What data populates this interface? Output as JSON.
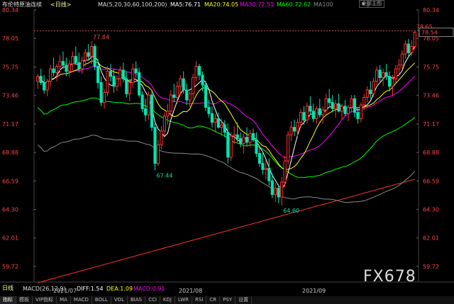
{
  "header": {
    "instrument": "布伦特原油连续",
    "period": "<日线>",
    "ma_params": "MA(5,20,30,60,100,200)",
    "ma5": "MA5:76.71",
    "ma20": "MA20:74.05",
    "ma30": "MA30:72.51",
    "ma60": "MA60:72.62",
    "ma100": "MA100",
    "all_button": "全部主图",
    "colors": {
      "ma5": "#ffffff",
      "ma20": "#ffff00",
      "ma30": "#ff00ff",
      "ma60": "#00ff00",
      "ma100": "#888888",
      "ma200": "#ff3333"
    }
  },
  "footer": {
    "period_label": "日线",
    "macd_label": "MACD(26,12,9)",
    "diff": "DIFF:1.54",
    "dea": "DEA:1.09",
    "macd": "MACD:0.91",
    "dates": [
      "2021/07",
      "2021/08",
      "2021/09"
    ],
    "tabs": [
      "指标",
      "模板",
      "VIP指标",
      "MA",
      "MACD",
      "BOLL",
      "VOL",
      "BIAS",
      "CCI",
      "KDJ",
      "LWR",
      "RSI",
      "CR",
      "PSY",
      "设置"
    ],
    "watermark": "FX678"
  },
  "chart_data": {
    "type": "candlestick",
    "ylim": [
      58.46,
      80.34
    ],
    "y_ticks": [
      "80.34",
      "78.05",
      "75.75",
      "73.46",
      "71.17",
      "68.88",
      "66.59",
      "64.30",
      "62.01",
      "59.72"
    ],
    "last_price": "78.54",
    "dashed_level": 78.65,
    "annotations": [
      {
        "label": "77.84",
        "value": 77.84,
        "index": 17
      },
      {
        "label": "67.44",
        "value": 67.44,
        "index": 37
      },
      {
        "label": "64.60",
        "value": 64.6,
        "index": 77
      },
      {
        "label": "78.65",
        "value": 78.65,
        "index": 119
      }
    ],
    "candles": [
      [
        74.6,
        75.2,
        74.0,
        75.0
      ],
      [
        75.0,
        75.6,
        74.3,
        74.5
      ],
      [
        74.5,
        75.1,
        73.6,
        73.9
      ],
      [
        73.9,
        74.8,
        73.4,
        74.6
      ],
      [
        74.6,
        75.9,
        74.2,
        75.6
      ],
      [
        75.6,
        76.5,
        75.0,
        75.3
      ],
      [
        75.3,
        76.0,
        74.6,
        75.8
      ],
      [
        75.8,
        76.7,
        75.2,
        76.2
      ],
      [
        76.2,
        77.0,
        75.6,
        75.9
      ],
      [
        75.9,
        76.5,
        75.0,
        75.4
      ],
      [
        75.4,
        76.3,
        74.9,
        76.0
      ],
      [
        76.0,
        77.0,
        75.5,
        76.6
      ],
      [
        76.6,
        77.4,
        76.0,
        76.1
      ],
      [
        76.1,
        76.9,
        75.3,
        75.6
      ],
      [
        75.6,
        76.6,
        75.2,
        76.3
      ],
      [
        76.3,
        77.2,
        75.8,
        76.9
      ],
      [
        76.9,
        77.6,
        76.3,
        76.6
      ],
      [
        76.6,
        77.84,
        76.0,
        77.4
      ],
      [
        77.4,
        77.6,
        75.5,
        75.8
      ],
      [
        75.8,
        76.4,
        74.0,
        74.5
      ],
      [
        74.5,
        75.0,
        72.6,
        72.9
      ],
      [
        72.9,
        74.0,
        72.4,
        73.7
      ],
      [
        73.7,
        75.8,
        73.4,
        75.4
      ],
      [
        75.4,
        76.0,
        74.6,
        75.0
      ],
      [
        75.0,
        75.6,
        73.7,
        74.2
      ],
      [
        74.2,
        75.1,
        73.8,
        74.8
      ],
      [
        74.8,
        75.8,
        74.2,
        75.5
      ],
      [
        75.5,
        76.1,
        74.5,
        74.8
      ],
      [
        74.8,
        75.4,
        73.3,
        73.6
      ],
      [
        73.6,
        74.8,
        73.0,
        74.5
      ],
      [
        74.5,
        76.0,
        74.1,
        75.6
      ],
      [
        75.6,
        76.2,
        74.9,
        75.3
      ],
      [
        75.3,
        75.7,
        73.3,
        73.5
      ],
      [
        73.5,
        73.8,
        72.1,
        72.4
      ],
      [
        72.4,
        73.2,
        71.4,
        71.9
      ],
      [
        71.9,
        73.8,
        71.5,
        73.5
      ],
      [
        73.5,
        73.8,
        70.6,
        70.9
      ],
      [
        70.9,
        71.2,
        67.44,
        68.0
      ],
      [
        68.0,
        69.9,
        67.8,
        69.5
      ],
      [
        69.5,
        71.0,
        69.1,
        70.6
      ],
      [
        70.6,
        72.1,
        70.2,
        71.8
      ],
      [
        71.8,
        72.8,
        71.1,
        72.2
      ],
      [
        72.2,
        73.9,
        71.8,
        73.5
      ],
      [
        73.5,
        74.4,
        72.9,
        73.3
      ],
      [
        73.3,
        74.6,
        72.8,
        74.2
      ],
      [
        74.2,
        75.1,
        73.5,
        74.8
      ],
      [
        74.8,
        75.4,
        73.6,
        73.9
      ],
      [
        73.9,
        74.4,
        72.7,
        73.1
      ],
      [
        73.1,
        73.9,
        72.5,
        73.6
      ],
      [
        73.6,
        75.2,
        73.2,
        74.9
      ],
      [
        74.9,
        76.2,
        74.6,
        75.8
      ],
      [
        75.8,
        76.0,
        74.7,
        75.1
      ],
      [
        75.1,
        75.4,
        73.8,
        74.3
      ],
      [
        74.3,
        74.6,
        72.2,
        72.5
      ],
      [
        72.5,
        73.1,
        71.7,
        72.0
      ],
      [
        72.0,
        72.6,
        70.9,
        71.3
      ],
      [
        71.3,
        72.0,
        70.6,
        71.6
      ],
      [
        71.6,
        72.1,
        70.8,
        70.9
      ],
      [
        70.9,
        71.6,
        70.2,
        71.1
      ],
      [
        71.1,
        71.5,
        70.1,
        70.5
      ],
      [
        70.5,
        71.2,
        68.0,
        68.5
      ],
      [
        68.5,
        70.5,
        68.2,
        70.2
      ],
      [
        70.2,
        71.0,
        69.6,
        70.3
      ],
      [
        70.3,
        71.3,
        69.7,
        70.0
      ],
      [
        70.0,
        70.5,
        69.3,
        69.6
      ],
      [
        69.6,
        70.4,
        68.8,
        70.1
      ],
      [
        70.1,
        70.9,
        69.4,
        69.7
      ],
      [
        69.7,
        70.7,
        69.3,
        70.4
      ],
      [
        70.4,
        70.8,
        69.7,
        69.9
      ],
      [
        69.9,
        70.5,
        68.5,
        68.8
      ],
      [
        68.8,
        69.4,
        67.7,
        68.0
      ],
      [
        68.0,
        68.9,
        67.1,
        67.5
      ],
      [
        67.5,
        68.3,
        66.7,
        67.6
      ],
      [
        67.6,
        68.4,
        66.2,
        66.6
      ],
      [
        66.6,
        67.2,
        65.2,
        65.5
      ],
      [
        65.5,
        66.4,
        64.9,
        66.0
      ],
      [
        66.0,
        66.3,
        64.8,
        65.3
      ],
      [
        65.3,
        66.9,
        64.6,
        66.5
      ],
      [
        66.5,
        68.6,
        66.1,
        68.2
      ],
      [
        68.2,
        70.6,
        67.9,
        70.3
      ],
      [
        70.3,
        71.4,
        69.8,
        70.9
      ],
      [
        70.9,
        71.5,
        70.2,
        70.6
      ],
      [
        70.6,
        71.6,
        70.1,
        71.3
      ],
      [
        71.3,
        72.4,
        70.9,
        72.1
      ],
      [
        72.1,
        72.6,
        71.1,
        71.5
      ],
      [
        71.5,
        72.9,
        71.2,
        72.6
      ],
      [
        72.6,
        73.4,
        71.9,
        72.2
      ],
      [
        72.2,
        72.8,
        71.3,
        71.6
      ],
      [
        71.6,
        72.6,
        71.2,
        72.4
      ],
      [
        72.4,
        73.2,
        71.7,
        71.9
      ],
      [
        71.9,
        72.6,
        71.2,
        72.3
      ],
      [
        72.3,
        73.6,
        71.9,
        73.2
      ],
      [
        73.2,
        74.0,
        72.6,
        72.9
      ],
      [
        72.9,
        73.5,
        72.1,
        72.4
      ],
      [
        72.4,
        73.1,
        71.7,
        72.8
      ],
      [
        72.8,
        73.6,
        72.1,
        72.2
      ],
      [
        72.2,
        72.8,
        71.5,
        72.6
      ],
      [
        72.6,
        73.1,
        71.8,
        72.0
      ],
      [
        72.0,
        72.7,
        71.4,
        72.5
      ],
      [
        72.5,
        73.5,
        72.1,
        73.2
      ],
      [
        73.2,
        73.5,
        71.7,
        72.1
      ],
      [
        72.1,
        72.5,
        71.2,
        71.6
      ],
      [
        71.6,
        72.9,
        71.3,
        72.7
      ],
      [
        72.7,
        73.6,
        72.3,
        73.3
      ],
      [
        73.3,
        74.2,
        72.9,
        73.9
      ],
      [
        73.9,
        74.6,
        73.2,
        73.6
      ],
      [
        73.6,
        74.9,
        73.3,
        74.6
      ],
      [
        74.6,
        75.8,
        74.3,
        75.5
      ],
      [
        75.5,
        75.9,
        74.6,
        74.9
      ],
      [
        74.9,
        75.6,
        74.2,
        75.3
      ],
      [
        75.3,
        76.0,
        74.7,
        75.0
      ],
      [
        75.0,
        75.4,
        73.8,
        74.2
      ],
      [
        74.2,
        75.1,
        73.4,
        74.8
      ],
      [
        74.8,
        75.9,
        74.5,
        75.6
      ],
      [
        75.6,
        76.4,
        75.1,
        75.9
      ],
      [
        75.9,
        77.1,
        75.6,
        76.8
      ],
      [
        76.8,
        77.9,
        76.4,
        77.6
      ],
      [
        77.6,
        78.0,
        76.5,
        76.9
      ],
      [
        76.9,
        77.9,
        76.6,
        77.4
      ],
      [
        77.4,
        78.65,
        77.1,
        78.54
      ]
    ]
  }
}
